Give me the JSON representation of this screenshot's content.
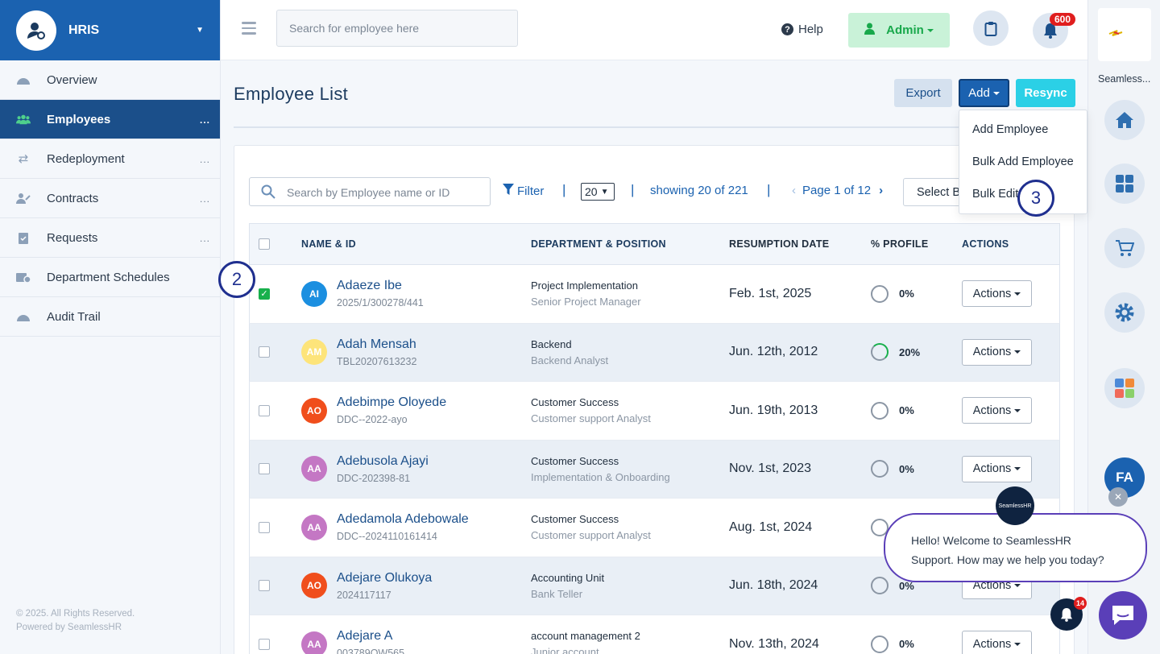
{
  "sidebar": {
    "brand": "HRIS",
    "items": [
      {
        "label": "Overview",
        "icon": "gauge-icon"
      },
      {
        "label": "Employees",
        "icon": "users-icon",
        "more": "..."
      },
      {
        "label": "Redeployment",
        "icon": "swap-icon",
        "more": "..."
      },
      {
        "label": "Contracts",
        "icon": "contract-icon",
        "more": "..."
      },
      {
        "label": "Requests",
        "icon": "clipboard-check-icon",
        "more": "..."
      },
      {
        "label": "Department Schedules",
        "icon": "calendar-clock-icon"
      },
      {
        "label": "Audit Trail",
        "icon": "gauge-icon"
      }
    ],
    "footer_line1": "© 2025. All Rights Reserved.",
    "footer_line2": "Powered by SeamlessHR"
  },
  "topbar": {
    "search_placeholder": "Search for employee here",
    "help": "Help",
    "admin": "Admin",
    "notifications": "600"
  },
  "rail": {
    "label": "Seamless..."
  },
  "main": {
    "title": "Employee List",
    "export": "Export",
    "add": "Add",
    "resync": "Resync",
    "add_menu": [
      "Add Employee",
      "Bulk Add Employee",
      "Bulk Edit"
    ],
    "search_placeholder": "Search by Employee name or ID",
    "filter": "Filter",
    "page_size": "20",
    "showing": "showing 20 of 221",
    "page": "Page 1 of 12",
    "select_bulk": "Select B",
    "columns": [
      "NAME & ID",
      "DEPARTMENT & POSITION",
      "RESUMPTION DATE",
      "% PROFILE",
      "ACTIONS"
    ],
    "rows": [
      {
        "initials": "AI",
        "color": "#1b8fe0",
        "name": "Adaeze Ibe",
        "id": "2025/1/300278/441",
        "dept": "Project Implementation",
        "pos": "Senior Project Manager",
        "date": "Feb. 1st, 2025",
        "profile": "0%",
        "checked": true
      },
      {
        "initials": "AM",
        "color": "#fde47a",
        "name": "Adah Mensah",
        "id": "TBL20207613232",
        "dept": "Backend",
        "pos": "Backend Analyst",
        "date": "Jun. 12th, 2012",
        "profile": "20%",
        "checked": false
      },
      {
        "initials": "AO",
        "color": "#f04e1c",
        "name": "Adebimpe Oloyede",
        "id": "DDC--2022-ayo",
        "dept": "Customer Success",
        "pos": "Customer support Analyst",
        "date": "Jun. 19th, 2013",
        "profile": "0%",
        "checked": false
      },
      {
        "initials": "AA",
        "color": "#c477c4",
        "name": "Adebusola Ajayi",
        "id": "DDC-202398-81",
        "dept": "Customer Success",
        "pos": "Implementation & Onboarding",
        "date": "Nov. 1st, 2023",
        "profile": "0%",
        "checked": false
      },
      {
        "initials": "AA",
        "color": "#c477c4",
        "name": "Adedamola Adebowale",
        "id": "DDC--2024110161414",
        "dept": "Customer Success",
        "pos": "Customer support Analyst",
        "date": "Aug. 1st, 2024",
        "profile": "",
        "checked": false
      },
      {
        "initials": "AO",
        "color": "#f04e1c",
        "name": "Adejare Olukoya",
        "id": "2024117117",
        "dept": "Accounting Unit",
        "pos": "Bank Teller",
        "date": "Jun. 18th, 2024",
        "profile": "0%",
        "checked": false
      },
      {
        "initials": "AA",
        "color": "#c477c4",
        "name": "Adejare A",
        "id": "003789QW565",
        "dept": "account management 2",
        "pos": "Junior account",
        "date": "Nov. 13th, 2024",
        "profile": "0%",
        "checked": false
      }
    ],
    "actions_label": "Actions"
  },
  "steps": {
    "two": "2",
    "three": "3"
  },
  "chat": {
    "message_line1": "Hello! Welcome to SeamlessHR",
    "message_line2": "Support. How may we help you today?",
    "logo": "SeamlessHR",
    "bell_count": "14",
    "avatar": "FA"
  }
}
